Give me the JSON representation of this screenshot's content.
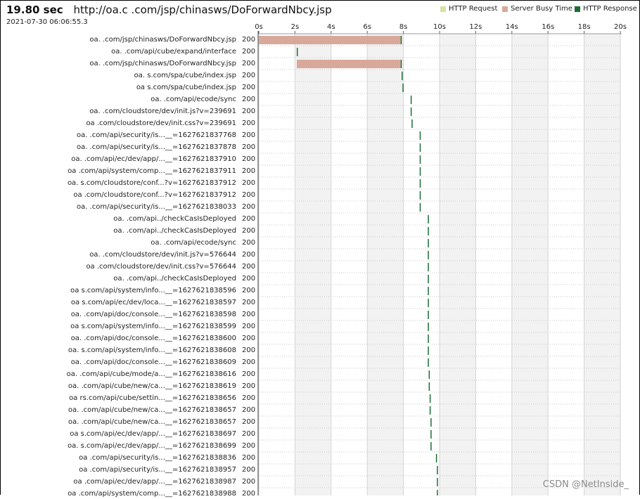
{
  "header": {
    "duration": "19.80 sec",
    "url": "http://oa.с                .com/jsp/chinasws/DoForwardNbcy.jsp",
    "timestamp": "2021-07-30 06:06:55.3"
  },
  "legend": [
    {
      "label": "HTTP Request",
      "color": "#d6e4a3"
    },
    {
      "label": "Server Busy Time",
      "color": "#d8a99a"
    },
    {
      "label": "HTTP Response",
      "color": "#1a6e35"
    }
  ],
  "watermark": "CSDN @NetInside_",
  "chart_data": {
    "type": "waterfall",
    "xlabel": "",
    "x_ticks": [
      "0s",
      "2s",
      "4s",
      "6s",
      "8s",
      "10s",
      "12s",
      "14s",
      "16s",
      "18s",
      "20s"
    ],
    "xlim": [
      0,
      20
    ],
    "rows": [
      {
        "label": "oa.              .com/jsp/chinasws/DoForwardNbcy.jsp",
        "status": "200",
        "start": 0.0,
        "busy": 7.85,
        "resp": 0.05
      },
      {
        "label": "oa.              .com/api/cube/expand/interface",
        "status": "200",
        "start": 2.1,
        "busy": 0.0,
        "resp": 0.05
      },
      {
        "label": "oa.              .com/jsp/chinasws/DoForwardNbcy.jsp",
        "status": "200",
        "start": 2.1,
        "busy": 5.75,
        "resp": 0.05
      },
      {
        "label": "oa.           s.com/spa/cube/index.jsp",
        "status": "200",
        "start": 7.9,
        "busy": 0.0,
        "resp": 0.05
      },
      {
        "label": "oa           s.com/spa/cube/index.jsp",
        "status": "200",
        "start": 7.95,
        "busy": 0.0,
        "resp": 0.05
      },
      {
        "label": "oa.            .com/api/ecode/sync",
        "status": "200",
        "start": 8.4,
        "busy": 0.0,
        "resp": 0.05
      },
      {
        "label": "oa.              .com/cloudstore/dev/init.js?v=239691",
        "status": "200",
        "start": 8.4,
        "busy": 0.0,
        "resp": 0.05
      },
      {
        "label": "oa              .com/cloudstore/dev/init.css?v=239691",
        "status": "200",
        "start": 8.45,
        "busy": 0.0,
        "resp": 0.05
      },
      {
        "label": "oa.            .com/api/security/is...__=1627621837768",
        "status": "200",
        "start": 8.9,
        "busy": 0.0,
        "resp": 0.05
      },
      {
        "label": "oa.            .com/api/security/is...__=1627621837878",
        "status": "200",
        "start": 8.9,
        "busy": 0.0,
        "resp": 0.05
      },
      {
        "label": "oa.           .com/api/ec/dev/app/...__=1627621837910",
        "status": "200",
        "start": 8.9,
        "busy": 0.0,
        "resp": 0.05
      },
      {
        "label": "oa             .com/api/system/comp...__=1627621837911",
        "status": "200",
        "start": 8.9,
        "busy": 0.0,
        "resp": 0.05
      },
      {
        "label": "oa.           s.com/cloudstore/conf...?v=1627621837912",
        "status": "200",
        "start": 8.9,
        "busy": 0.0,
        "resp": 0.05
      },
      {
        "label": "oa            .com/cloudstore/conf...?v=1627621837912",
        "status": "200",
        "start": 8.9,
        "busy": 0.0,
        "resp": 0.05
      },
      {
        "label": "oa.            .com/api/security/is...__=1627621838033",
        "status": "200",
        "start": 8.9,
        "busy": 0.0,
        "resp": 0.05
      },
      {
        "label": "oa.              .com/api../checkCasIsDeployed",
        "status": "200",
        "start": 9.35,
        "busy": 0.0,
        "resp": 0.05
      },
      {
        "label": "oa.              .com/api../checkCasIsDeployed",
        "status": "200",
        "start": 9.35,
        "busy": 0.0,
        "resp": 0.05
      },
      {
        "label": "oa.            .com/api/ecode/sync",
        "status": "200",
        "start": 9.35,
        "busy": 0.0,
        "resp": 0.05
      },
      {
        "label": "oa.              .com/cloudstore/dev/init.js?v=576644",
        "status": "200",
        "start": 9.35,
        "busy": 0.0,
        "resp": 0.05
      },
      {
        "label": "oa              .com/cloudstore/dev/init.css?v=576644",
        "status": "200",
        "start": 9.35,
        "busy": 0.0,
        "resp": 0.05
      },
      {
        "label": "oa.              .com/api../checkCasIsDeployed",
        "status": "200",
        "start": 9.35,
        "busy": 0.0,
        "resp": 0.05
      },
      {
        "label": "oa           s.com/api/system/info...__=1627621838596",
        "status": "200",
        "start": 9.35,
        "busy": 0.0,
        "resp": 0.05
      },
      {
        "label": "oa           s.com/api/ec/dev/loca...__=1627621838597",
        "status": "200",
        "start": 9.35,
        "busy": 0.0,
        "resp": 0.05
      },
      {
        "label": "oa.              .com/api/doc/console...__=1627621838598",
        "status": "200",
        "start": 9.35,
        "busy": 0.0,
        "resp": 0.05
      },
      {
        "label": "oa           s.com/api/system/info...__=1627621838599",
        "status": "200",
        "start": 9.35,
        "busy": 0.0,
        "resp": 0.05
      },
      {
        "label": "oa.              .com/api/doc/console...__=1627621838600",
        "status": "200",
        "start": 9.35,
        "busy": 0.0,
        "resp": 0.05
      },
      {
        "label": "oa.           s.com/api/system/info...__=1627621838608",
        "status": "200",
        "start": 9.35,
        "busy": 0.0,
        "resp": 0.05
      },
      {
        "label": "oa.              .com/api/doc/console...__=1627621838609",
        "status": "200",
        "start": 9.35,
        "busy": 0.0,
        "resp": 0.05
      },
      {
        "label": "oa.           .com/api/cube/mode/a...__=1627621838616",
        "status": "200",
        "start": 9.4,
        "busy": 0.0,
        "resp": 0.05
      },
      {
        "label": "oa.           .com/api/cube/new/ca...__=1627621838619",
        "status": "200",
        "start": 9.4,
        "busy": 0.0,
        "resp": 0.05
      },
      {
        "label": "oa         rs.com/api/cube/settin...__=1627621838656",
        "status": "200",
        "start": 9.45,
        "busy": 0.0,
        "resp": 0.05
      },
      {
        "label": "oa.           .com/api/cube/new/ca...__=1627621838657",
        "status": "200",
        "start": 9.45,
        "busy": 0.0,
        "resp": 0.05
      },
      {
        "label": "oa.           .com/api/cube/new/ca...__=1627621838657",
        "status": "200",
        "start": 9.5,
        "busy": 0.0,
        "resp": 0.05
      },
      {
        "label": "oa           s.com/api/ec/dev/app/...__=1627621838697",
        "status": "200",
        "start": 9.5,
        "busy": 0.0,
        "resp": 0.05
      },
      {
        "label": "oa.           s.com/api/ec/dev/app/...__=1627621838699",
        "status": "200",
        "start": 9.5,
        "busy": 0.0,
        "resp": 0.05
      },
      {
        "label": "oa            .com/api/security/is...__=1627621838836",
        "status": "200",
        "start": 9.8,
        "busy": 0.0,
        "resp": 0.05
      },
      {
        "label": "oa            .com/api/security/is...__=1627621838957",
        "status": "200",
        "start": 9.85,
        "busy": 0.0,
        "resp": 0.05
      },
      {
        "label": "oa             .com/api/ec/dev/app/...__=1627621838987",
        "status": "200",
        "start": 9.85,
        "busy": 0.0,
        "resp": 0.05
      },
      {
        "label": "oa             .com/api/system/comp...__=1627621838988",
        "status": "200",
        "start": 9.85,
        "busy": 0.0,
        "resp": 0.05
      }
    ]
  }
}
